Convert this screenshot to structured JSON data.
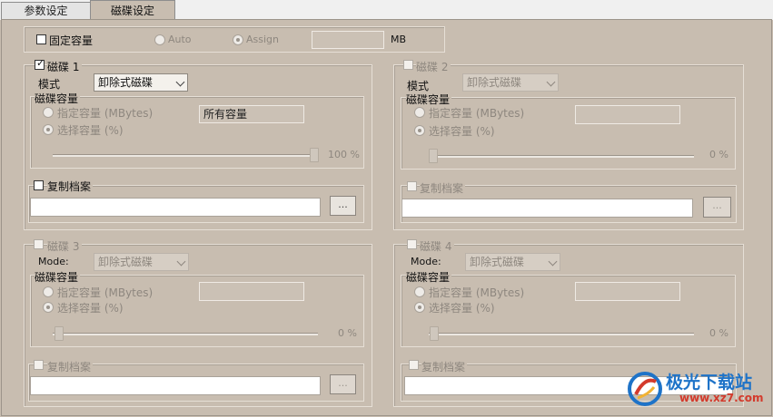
{
  "tabs": [
    {
      "label": "参数设定",
      "active": false
    },
    {
      "label": "磁碟设定",
      "active": true
    }
  ],
  "fixed_capacity": {
    "label": "固定容量",
    "checked": false,
    "auto_label": "Auto",
    "assign_label": "Assign",
    "value": "",
    "unit": "MB"
  },
  "disk1": {
    "title": "磁碟 1",
    "enabled": true,
    "mode_label": "模式",
    "mode_value": "卸除式磁碟",
    "capacity_group": "磁碟容量",
    "specify_label": "指定容量 (MBytes)",
    "select_label": "选择容量 (%)",
    "capacity_value": "所有容量",
    "percent": 100,
    "percent_text": "100 %",
    "copy_label": "复制档案",
    "browse_label": "..."
  },
  "disk2": {
    "title": "磁碟 2",
    "enabled": false,
    "mode_label": "模式",
    "mode_value": "卸除式磁碟",
    "capacity_group": "磁碟容量",
    "specify_label": "指定容量 (MBytes)",
    "select_label": "选择容量 (%)",
    "capacity_value": "",
    "percent": 0,
    "percent_text": "0 %",
    "copy_label": "复制档案",
    "browse_label": "..."
  },
  "disk3": {
    "title": "磁碟 3",
    "enabled": false,
    "mode_label": "Mode:",
    "mode_value": "卸除式磁碟",
    "capacity_group": "磁碟容量",
    "specify_label": "指定容量 (MBytes)",
    "select_label": "选择容量 (%)",
    "capacity_value": "",
    "percent": 0,
    "percent_text": "0 %",
    "copy_label": "复制档案",
    "browse_label": "..."
  },
  "disk4": {
    "title": "磁碟 4",
    "enabled": false,
    "mode_label": "Mode:",
    "mode_value": "卸除式磁碟",
    "capacity_group": "磁碟容量",
    "specify_label": "指定容量 (MBytes)",
    "select_label": "选择容量 (%)",
    "capacity_value": "",
    "percent": 0,
    "percent_text": "0 %",
    "copy_label": "复制档案",
    "browse_label": "..."
  },
  "watermark": {
    "name": "极光下载站",
    "url": "www.xz7.com"
  },
  "colors": {
    "panel_bg": "#c8bdb0",
    "tab_strip": "#f0f0f0",
    "watermark_red": "#d33a2c",
    "watermark_blue": "#1e73c8"
  }
}
